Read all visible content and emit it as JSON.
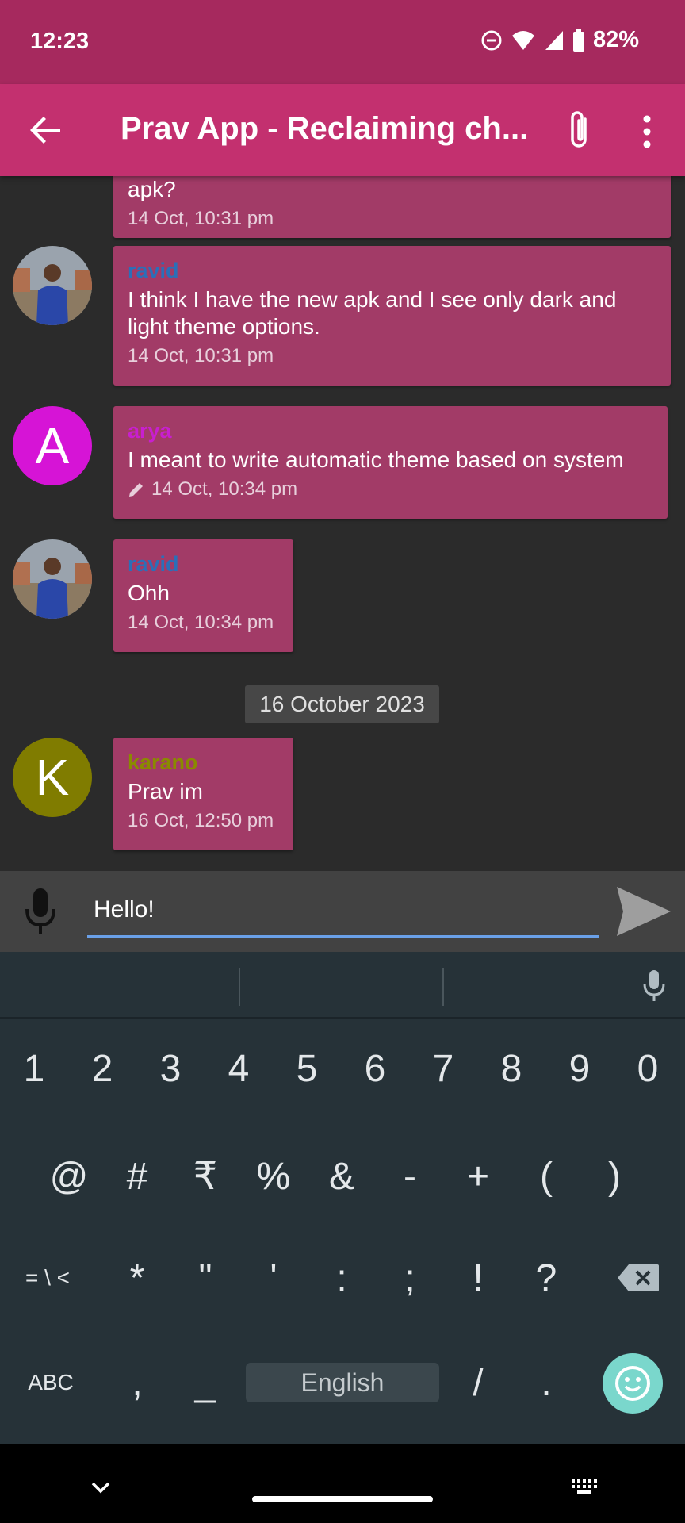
{
  "status": {
    "time": "12:23",
    "battery": "82%"
  },
  "toolbar": {
    "title": "Prav App - Reclaiming ch..."
  },
  "messages": [
    {
      "sender": "",
      "text": "apk?",
      "timestamp": "14 Oct, 10:31 pm"
    },
    {
      "sender": "ravid",
      "sender_color": "#2b6fb8",
      "text": "I think I have the new apk and I see only dark and light theme options.",
      "timestamp": "14 Oct, 10:31 pm"
    },
    {
      "sender": "arya",
      "sender_color": "#c81fcf",
      "avatar_letter": "A",
      "avatar_color": "#d614d6",
      "text": "I meant to write automatic theme based on system",
      "timestamp": "14 Oct, 10:34 pm",
      "edited": true
    },
    {
      "sender": "ravid",
      "sender_color": "#2b6fb8",
      "text": "Ohh",
      "timestamp": "14 Oct, 10:34 pm"
    },
    {
      "sender": "karano",
      "sender_color": "#8a8a00",
      "avatar_letter": "K",
      "avatar_color": "#807c00",
      "text": "Prav im",
      "timestamp": "16 Oct, 12:50 pm"
    }
  ],
  "date_divider": "16 October 2023",
  "compose": {
    "value": "Hello!"
  },
  "keyboard": {
    "row1": [
      "1",
      "2",
      "3",
      "4",
      "5",
      "6",
      "7",
      "8",
      "9",
      "0"
    ],
    "row2": [
      "@",
      "#",
      "₹",
      "%",
      "&",
      "-",
      "+",
      "(",
      ")"
    ],
    "row3": [
      "= \\ <",
      "*",
      "\"",
      "'",
      ":",
      ";",
      "!",
      "?"
    ],
    "row4": {
      "abc": "ABC",
      "comma": ",",
      "underscore": "_",
      "space": "English",
      "slash": "/",
      "period": "."
    }
  }
}
